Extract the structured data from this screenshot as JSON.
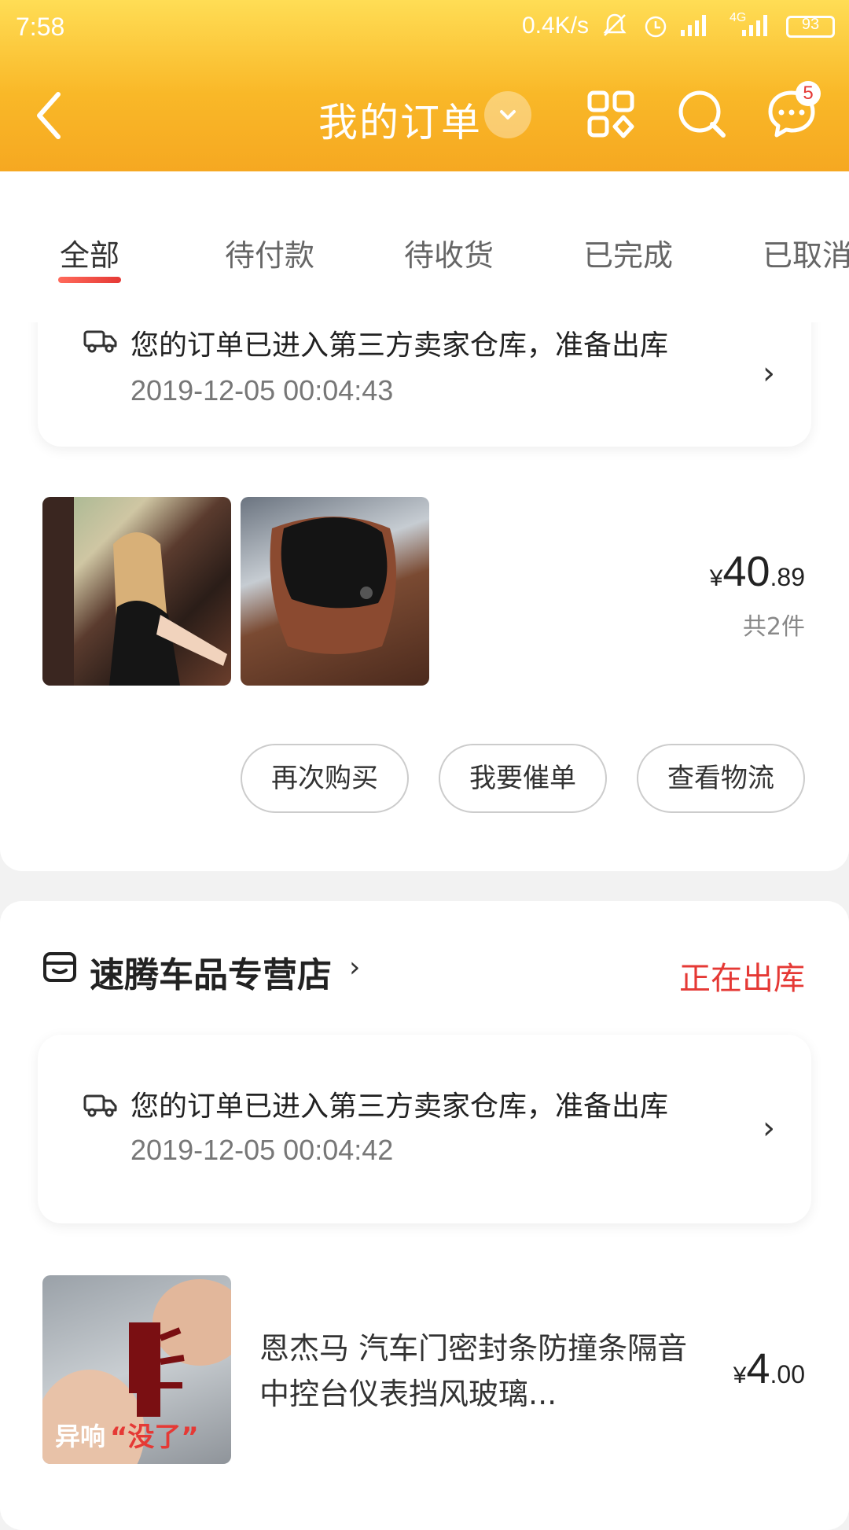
{
  "status_bar": {
    "time": "7:58",
    "network_speed": "0.4K/s",
    "battery": "93",
    "net_type": "4G"
  },
  "header": {
    "title": "我的订单",
    "message_badge": "5",
    "accent_color": "#f9b828"
  },
  "tabs": [
    {
      "label": "全部",
      "active": true
    },
    {
      "label": "待付款",
      "active": false
    },
    {
      "label": "待收货",
      "active": false
    },
    {
      "label": "已完成",
      "active": false
    },
    {
      "label": "已取消",
      "active": false
    }
  ],
  "order1": {
    "logistics_text": "您的订单已进入第三方卖家仓库，准备出库",
    "logistics_time": "2019-12-05 00:04:43",
    "price_symbol": "¥",
    "price_int": "40",
    "price_dec": ".89",
    "quantity": "共2件",
    "buttons": {
      "buy_again": "再次购买",
      "urge": "我要催单",
      "logistics": "查看物流"
    }
  },
  "order2": {
    "store_name": "速腾车品专营店",
    "status": "正在出库",
    "logistics_text": "您的订单已进入第三方卖家仓库，准备出库",
    "logistics_time": "2019-12-05 00:04:42",
    "product_title": "恩杰马 汽车门密封条防撞条隔音中控台仪表挡风玻璃...",
    "image_caption_a": "异响",
    "image_caption_b": "“没了”",
    "price_symbol": "¥",
    "price_int": "4",
    "price_dec": ".00"
  }
}
